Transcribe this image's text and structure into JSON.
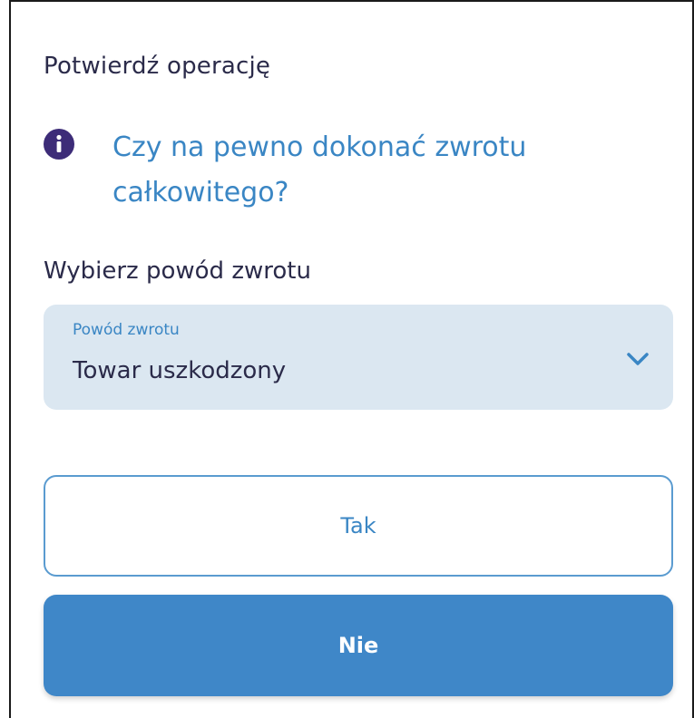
{
  "dialog": {
    "title": "Potwierdź operację",
    "message": "Czy na pewno dokonać zwrotu całkowitego?",
    "info_icon": "info-icon",
    "section_label": "Wybierz powód zwrotu"
  },
  "reason_select": {
    "label": "Powód zwrotu",
    "value": "Towar uszkodzony",
    "chevron_icon": "chevron-down-icon"
  },
  "buttons": {
    "yes_label": "Tak",
    "no_label": "Nie"
  },
  "colors": {
    "accent": "#3f87c8",
    "text_primary": "#2b2b4a",
    "text_link": "#3a86c4",
    "info_icon_bg": "#3d2c78",
    "select_bg": "#dbe7f1"
  }
}
